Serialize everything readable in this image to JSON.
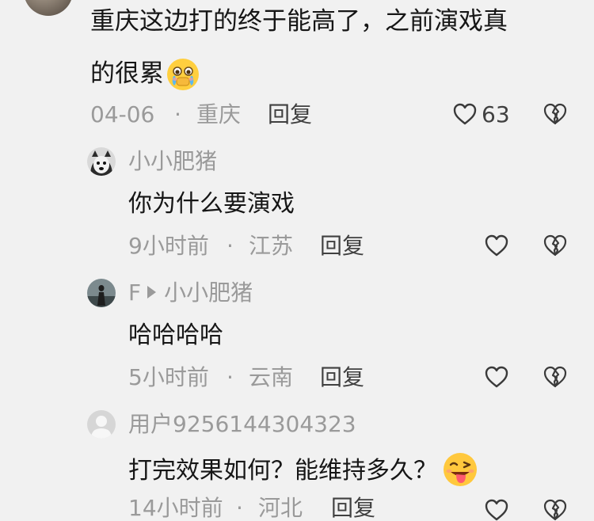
{
  "main_comment": {
    "text_line1": "重庆这边打的终于能高了，之前演戏真",
    "text_line2": "的很累",
    "emoji": "crying-face-emoji",
    "date": "04-06",
    "location": "重庆",
    "reply_label": "回复",
    "like_count": "63"
  },
  "replies": [
    {
      "username": "小小肥猪",
      "text": "你为什么要演戏",
      "time": "9小时前",
      "location": "江苏",
      "reply_label": "回复"
    },
    {
      "username": "F",
      "reply_to": "小小肥猪",
      "text": "哈哈哈哈",
      "time": "5小时前",
      "location": "云南",
      "reply_label": "回复"
    },
    {
      "username": "用户9256144304323",
      "text": "打完效果如何？能维持多久？",
      "emoji": "tongue-wink-emoji",
      "time": "14小时前",
      "location": "河北",
      "reply_label": "回复"
    }
  ],
  "separator": "·",
  "colors": {
    "background": "#f1f1f1",
    "text": "#161616",
    "meta": "#9a9a9a"
  }
}
